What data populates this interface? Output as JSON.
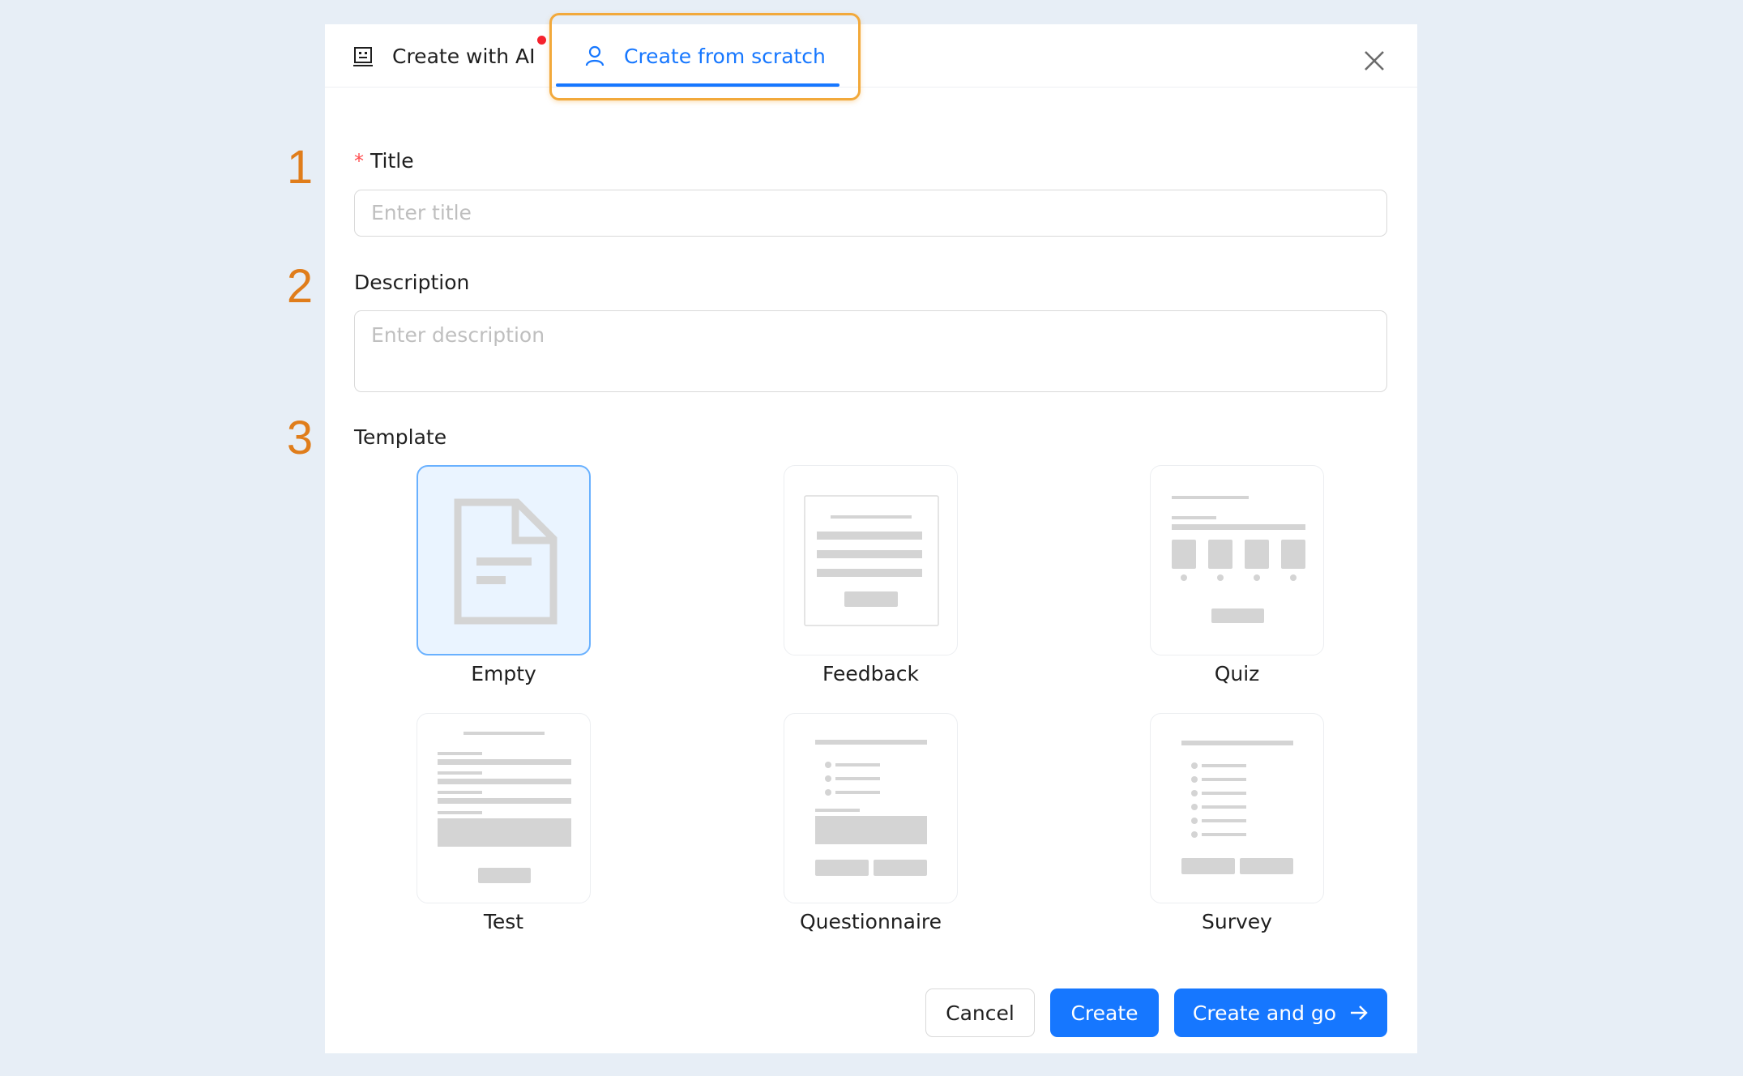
{
  "annotations": [
    "1",
    "2",
    "3"
  ],
  "tabs": {
    "ai": {
      "label": "Create with AI",
      "icon": "robot-icon",
      "has_notification_dot": true
    },
    "scratch": {
      "label": "Create from scratch",
      "icon": "user-icon",
      "active": true
    }
  },
  "form": {
    "title": {
      "label": "Title",
      "required_mark": "*",
      "placeholder": "Enter title",
      "value": ""
    },
    "description": {
      "label": "Description",
      "placeholder": "Enter description",
      "value": ""
    },
    "template": {
      "label": "Template",
      "selected": "Empty",
      "options": [
        {
          "name": "Empty"
        },
        {
          "name": "Feedback"
        },
        {
          "name": "Quiz"
        },
        {
          "name": "Test"
        },
        {
          "name": "Questionnaire"
        },
        {
          "name": "Survey"
        }
      ]
    }
  },
  "buttons": {
    "cancel": "Cancel",
    "create": "Create",
    "create_and_go": "Create and go"
  },
  "colors": {
    "primary": "#1677ff",
    "annotation": "#e07d1b",
    "highlight": "#f2a93b",
    "required": "#ff4d4f"
  }
}
